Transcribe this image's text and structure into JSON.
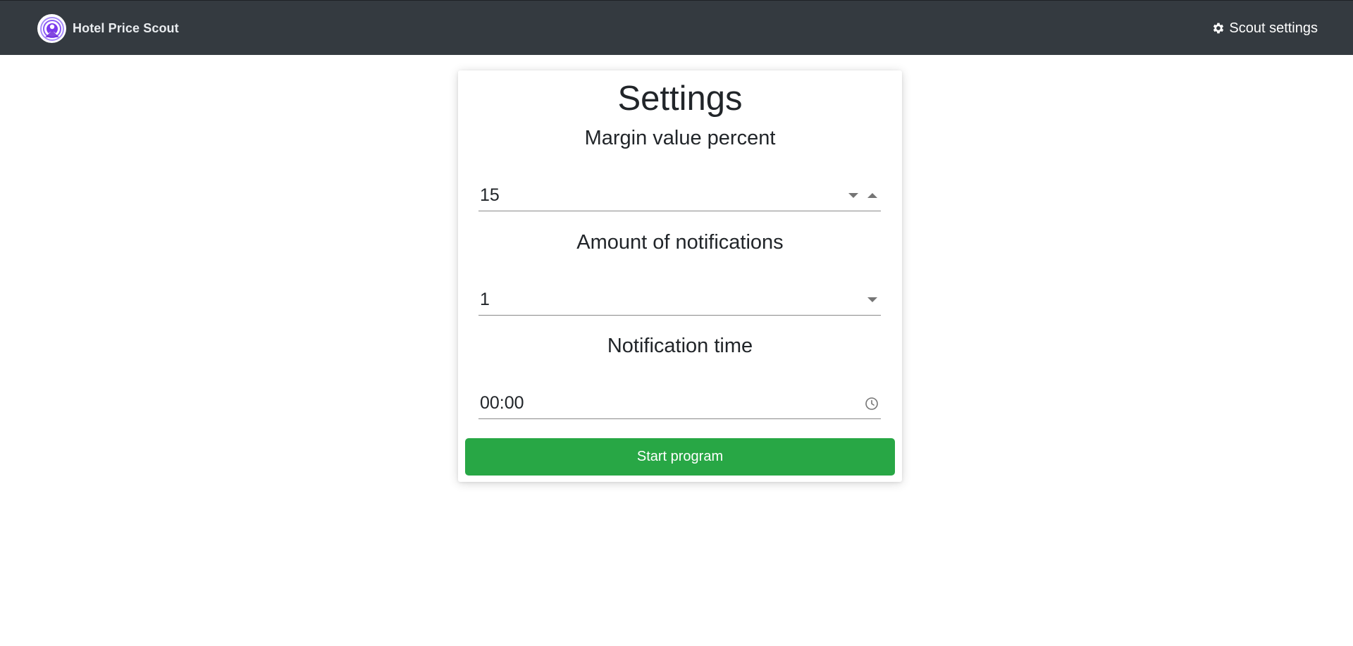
{
  "navbar": {
    "brand": "Hotel Price Scout",
    "settings_label": "Scout settings",
    "background": "#343a40",
    "logo_color": "#7c3aed"
  },
  "settings": {
    "title": "Settings",
    "margin": {
      "label": "Margin value percent",
      "value": "15"
    },
    "notifications": {
      "label": "Amount of notifications",
      "value": "1"
    },
    "time": {
      "label": "Notification time",
      "value": "00:00"
    },
    "start_button": "Start program",
    "button_color": "#28a745"
  }
}
